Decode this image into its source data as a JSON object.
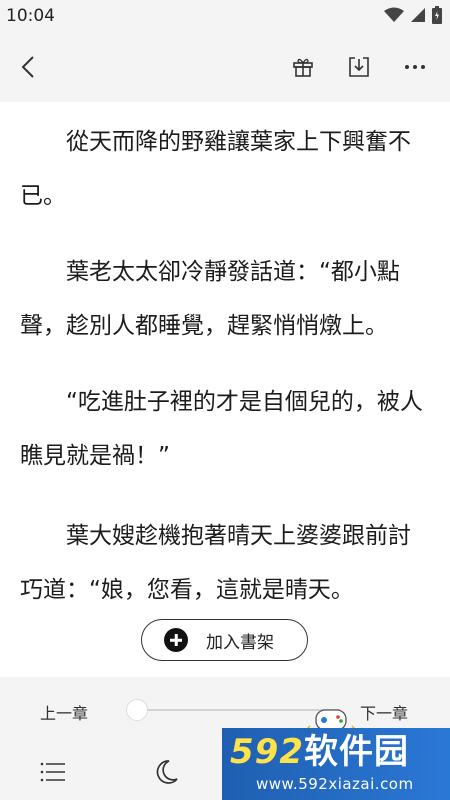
{
  "status_bar": {
    "time": "10:04",
    "icons": [
      "wifi-icon",
      "signal-icon",
      "battery-icon"
    ]
  },
  "toolbar": {
    "back_icon": "chevron-left-icon",
    "gift_icon": "gift-icon",
    "download_icon": "download-icon",
    "more_icon": "more-icon"
  },
  "content": {
    "paragraphs": [
      "從天而降的野雞讓葉家上下興奮不已。",
      "葉老太太卻冷靜發話道：“都小點聲，趁別人都睡覺，趕緊悄悄燉上。",
      "“吃進肚子裡的才是自個兒的，被人瞧見就是禍！”",
      "葉大嫂趁機抱著晴天上婆婆跟前討巧道：“娘，您看，這就是晴天。"
    ]
  },
  "add_to_shelf": {
    "label": "加入書架",
    "icon": "plus-circle-icon"
  },
  "bottom_panel": {
    "prev_chapter": "上一章",
    "next_chapter": "下一章",
    "progress": 0,
    "icons": [
      "menu-list-icon",
      "moon-icon"
    ]
  },
  "watermark": {
    "text_num": "592",
    "text_cn": "软件园",
    "url": "www.592xiazai.com"
  },
  "colors": {
    "accent": "#2a78d6",
    "background": "#f4f4f4",
    "page": "#ffffff"
  }
}
